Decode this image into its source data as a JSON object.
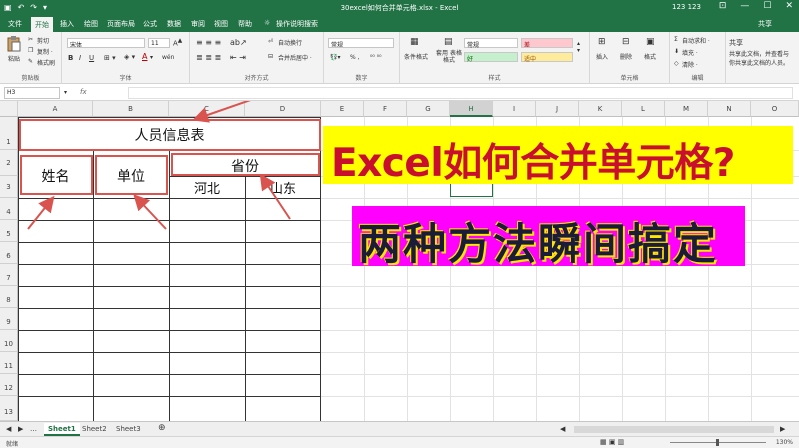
{
  "window": {
    "title": "30excel如何合并单元格.xlsx - Excel",
    "user": "123 123",
    "min_glyph": "—",
    "max_glyph": "☐",
    "close_glyph": "✕"
  },
  "menu": {
    "tabs": [
      "文件",
      "开始",
      "插入",
      "绘图",
      "页面布局",
      "公式",
      "数据",
      "审阅",
      "视图",
      "帮助",
      "操作说明搜索"
    ],
    "active": "开始",
    "share": "共享"
  },
  "ribbon": {
    "clipboard": {
      "paste": "粘贴",
      "cut": "剪切",
      "copy": "复制 ·",
      "format_painter": "格式刷",
      "label": "剪贴板"
    },
    "font": {
      "name": "宋体",
      "size": "11",
      "bold": "B",
      "italic": "I",
      "underline": "U",
      "wen": "wén",
      "label": "字体"
    },
    "alignment": {
      "wrap": "自动换行",
      "merge": "合并后居中 ·",
      "label": "对齐方式"
    },
    "number": {
      "format": "常规",
      "percent": "% ,",
      "label": "数字"
    },
    "styles": {
      "conditional": "条件格式",
      "table_format": "套用 表格格式",
      "normal": "常规",
      "bad": "差",
      "good": "好",
      "neutral": "适中",
      "label": "样式"
    },
    "cells": {
      "insert": "插入",
      "delete": "删除",
      "format": "格式",
      "label": "单元格"
    },
    "editing": {
      "autosum": "自动求和 ·",
      "fill": "填充 ·",
      "clear": "清除 ·",
      "label": "编辑"
    },
    "share_group": {
      "title": "共享",
      "line1": "共享此文档，并查看与",
      "line2": "你共享此文档的人员。"
    }
  },
  "formula_bar": {
    "name_box": "H3",
    "fx": "fx",
    "value": ""
  },
  "sheet": {
    "columns": [
      "A",
      "B",
      "C",
      "D",
      "E",
      "F",
      "G",
      "H",
      "I",
      "J",
      "K",
      "L",
      "M",
      "N",
      "O"
    ],
    "selected_column": "H",
    "rows": [
      "1",
      "2",
      "3",
      "4",
      "5",
      "6",
      "7",
      "8",
      "9",
      "10",
      "11",
      "12",
      "13"
    ],
    "table": {
      "title": "人员信息表",
      "name_header": "姓名",
      "unit_header": "单位",
      "province_header": "省份",
      "hebei": "河北",
      "shandong": "山东"
    },
    "banner_line1": "Excel如何合并单元格?",
    "banner_line2": "两种方法瞬间搞定",
    "colors": {
      "banner1_bg": "#ffff00",
      "banner1_text": "#c8102e",
      "banner2_bg": "#ff00ff",
      "banner2_text": "#1b1b3a",
      "annotation": "#d9534f"
    }
  },
  "sheet_tabs": {
    "tabs": [
      "Sheet1",
      "Sheet2",
      "Sheet3"
    ],
    "active": "Sheet1",
    "add": "⊕"
  },
  "status": {
    "ready": "就绪",
    "zoom": "130%"
  }
}
